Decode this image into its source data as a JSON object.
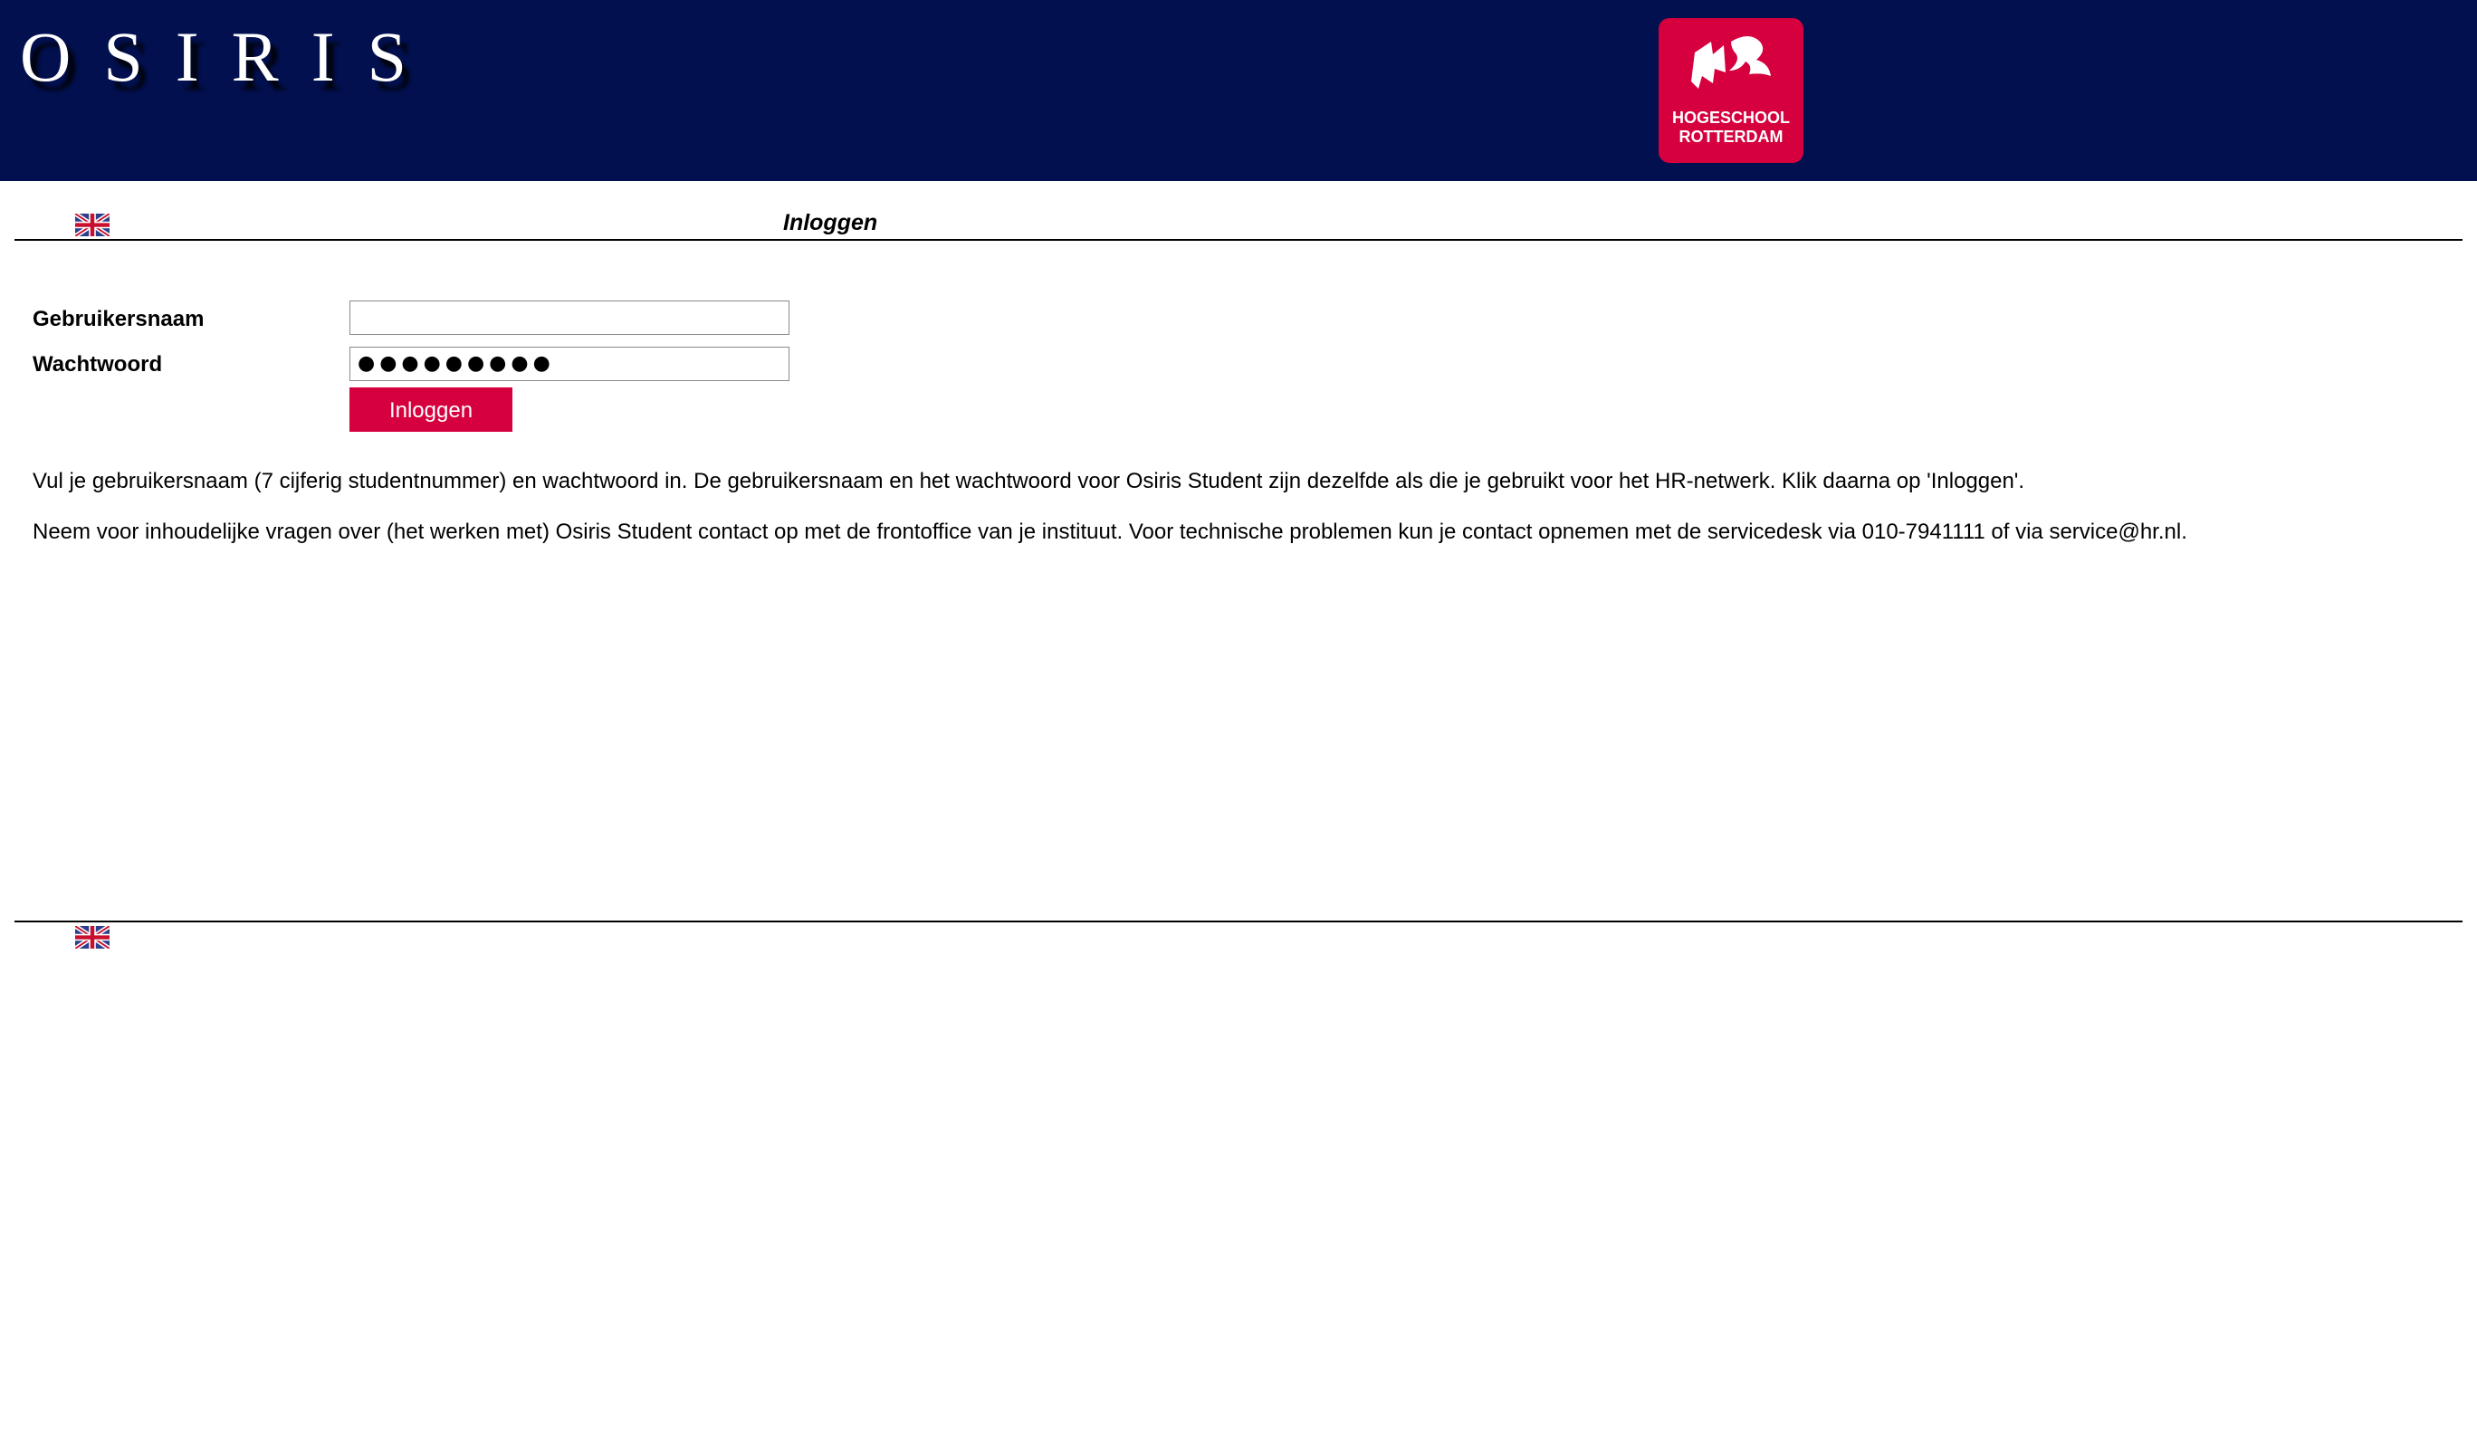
{
  "header": {
    "app_logo_text": "OSIRIS",
    "institution_logo": {
      "line1": "HOGESCHOOL",
      "line2": "ROTTERDAM",
      "color": "#d5003d"
    },
    "background_color": "#02104f"
  },
  "language": {
    "icon": "uk-flag-icon"
  },
  "page": {
    "title": "Inloggen"
  },
  "form": {
    "username_label": "Gebruikersnaam",
    "username_value": "",
    "password_label": "Wachtwoord",
    "password_value": "●●●●●●●●●",
    "submit_label": "Inloggen"
  },
  "info": {
    "line1": "Vul je gebruikersnaam (7 cijferig studentnummer) en wachtwoord in. De gebruikersnaam en het wachtwoord voor Osiris Student zijn dezelfde als die je gebruikt voor het HR-netwerk. Klik daarna op 'Inloggen'.",
    "line2": "Neem voor inhoudelijke vragen over (het werken met) Osiris Student contact op met de frontoffice van je instituut. Voor technische problemen kun je contact opnemen met de servicedesk via 010-7941111 of via service@hr.nl."
  }
}
